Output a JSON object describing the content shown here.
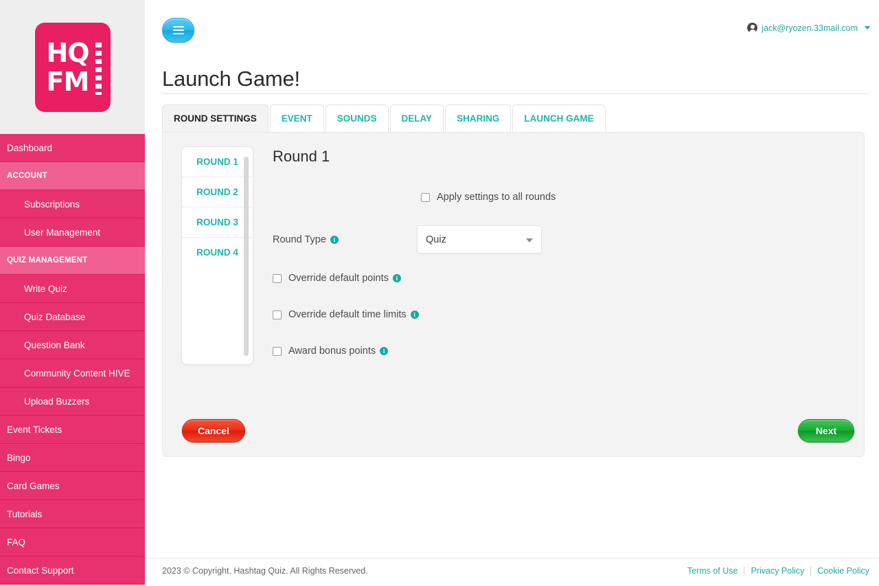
{
  "brand": {
    "logo_line1": "HQ",
    "logo_line2": "FM",
    "color": "#e91e63"
  },
  "sidebar": {
    "items": [
      {
        "label": "Dashboard",
        "type": "item"
      },
      {
        "label": "ACCOUNT",
        "type": "section"
      },
      {
        "label": "Subscriptions",
        "type": "sub"
      },
      {
        "label": "User Management",
        "type": "sub"
      },
      {
        "label": "QUIZ MANAGEMENT",
        "type": "section"
      },
      {
        "label": "Write Quiz",
        "type": "sub"
      },
      {
        "label": "Quiz Database",
        "type": "sub"
      },
      {
        "label": "Question Bank",
        "type": "sub"
      },
      {
        "label": "Community Content HIVE",
        "type": "sub"
      },
      {
        "label": "Upload Buzzers",
        "type": "sub"
      },
      {
        "label": "Event Tickets",
        "type": "item"
      },
      {
        "label": "Bingo",
        "type": "item"
      },
      {
        "label": "Card Games",
        "type": "item"
      },
      {
        "label": "Tutorials",
        "type": "item"
      },
      {
        "label": "FAQ",
        "type": "item"
      },
      {
        "label": "Contact Support",
        "type": "item"
      }
    ]
  },
  "topbar": {
    "menu_icon": "hamburger-icon",
    "account_icon": "person-icon",
    "account_email": "jack@ryozen.33mail.com",
    "account_caret": "chevron-down-icon"
  },
  "page": {
    "title": "Launch Game!"
  },
  "tabs": [
    {
      "label": "ROUND SETTINGS",
      "active": true
    },
    {
      "label": "EVENT",
      "active": false
    },
    {
      "label": "SOUNDS",
      "active": false
    },
    {
      "label": "DELAY",
      "active": false
    },
    {
      "label": "SHARING",
      "active": false
    },
    {
      "label": "LAUNCH GAME",
      "active": false
    }
  ],
  "rounds": [
    {
      "label": "ROUND 1"
    },
    {
      "label": "ROUND 2"
    },
    {
      "label": "ROUND 3"
    },
    {
      "label": "ROUND 4"
    }
  ],
  "form": {
    "heading": "Round 1",
    "apply_all_label": "Apply settings to all rounds",
    "apply_all_checked": false,
    "round_type_label": "Round Type",
    "round_type_value": "Quiz",
    "options": [
      {
        "label": "Override default points",
        "checked": false
      },
      {
        "label": "Override default time limits",
        "checked": false
      },
      {
        "label": "Award bonus points",
        "checked": false
      }
    ],
    "info_glyph": "i"
  },
  "actions": {
    "cancel_label": "Cancel",
    "next_label": "Next"
  },
  "footer": {
    "copyright": "2023 © Copyright. Hashtag Quiz. All Rights Reserved.",
    "links": [
      {
        "label": "Terms of Use"
      },
      {
        "label": "Privacy Policy"
      },
      {
        "label": "Cookie Policy"
      }
    ]
  }
}
